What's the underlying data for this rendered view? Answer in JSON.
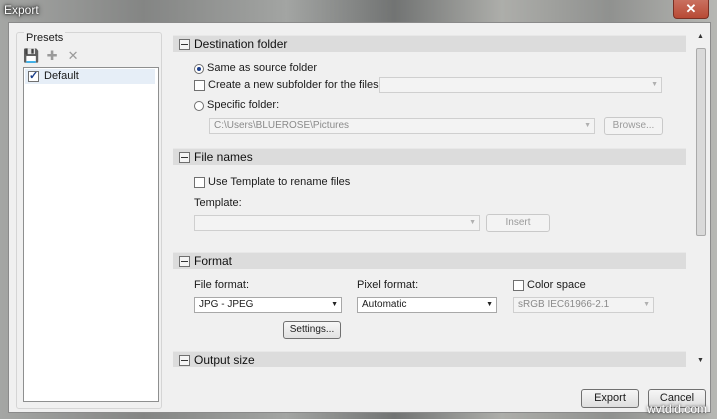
{
  "window": {
    "title": "Export",
    "close_glyph": "✕"
  },
  "presets": {
    "label": "Presets",
    "tools": [
      {
        "name": "save-icon",
        "glyph": "💾"
      },
      {
        "name": "add-icon",
        "glyph": "✚"
      },
      {
        "name": "delete-icon",
        "glyph": "✕"
      }
    ],
    "items": [
      {
        "label": "Default",
        "checked": true
      }
    ]
  },
  "destination": {
    "heading": "Destination folder",
    "same_as_source": "Same as source folder",
    "create_subfolder": "Create a new subfolder for the files:",
    "subfolder_value": "",
    "specific_folder": "Specific folder:",
    "folder_path": "C:\\Users\\BLUEROSE\\Pictures",
    "browse": "Browse..."
  },
  "file_names": {
    "heading": "File names",
    "use_template": "Use Template to rename files",
    "template_label": "Template:",
    "template_value": "",
    "insert": "Insert"
  },
  "format": {
    "heading": "Format",
    "file_format_label": "File format:",
    "file_format_value": "JPG - JPEG",
    "pixel_format_label": "Pixel format:",
    "pixel_format_value": "Automatic",
    "color_space_label": "Color space",
    "color_space_value": "sRGB IEC61966-2.1",
    "settings": "Settings..."
  },
  "output_size": {
    "heading": "Output size"
  },
  "footer": {
    "export": "Export",
    "cancel": "Cancel"
  },
  "watermark": "wvtdid.com"
}
